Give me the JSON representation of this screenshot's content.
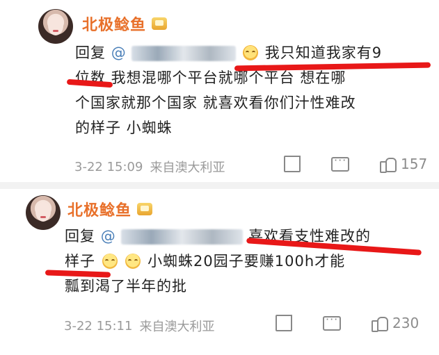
{
  "colors": {
    "username": "#e8702a",
    "mention": "#4a7fb8",
    "meta": "#9a9a9a",
    "underline": "#e81818"
  },
  "comments": [
    {
      "username": "北极鲶鱼",
      "reply_label": "回复",
      "mention_prefix": "@",
      "mention_visible_suffix": "",
      "text_line_1": "我只知道我家有9",
      "text_line_2": "位数 我想混哪个平台就哪个平台 想在哪",
      "text_line_3": "个国家就那个国家 就喜欢看你们汁性难改",
      "text_line_4": "的样子 小蜘蛛",
      "time": "3-22 15:09",
      "source": "来自澳大利亚",
      "likes": "157"
    },
    {
      "username": "北极鲶鱼",
      "reply_label": "回复",
      "mention_prefix": "@",
      "mention_visible_suffix": "",
      "text_line_1": "喜欢看支性难改的",
      "text_line_2": "样子",
      "text_line_2b": "小蜘蛛20园子要赚100h才能",
      "text_line_3": "瓢到渴了半年的批",
      "time": "3-22 15:11",
      "source": "来自澳大利亚",
      "likes": "230"
    }
  ],
  "icons": {
    "avatar": "avatar",
    "vip": "vip-badge",
    "share": "share-icon",
    "comment": "comment-icon",
    "like": "like-icon",
    "emoji": "emoji"
  }
}
